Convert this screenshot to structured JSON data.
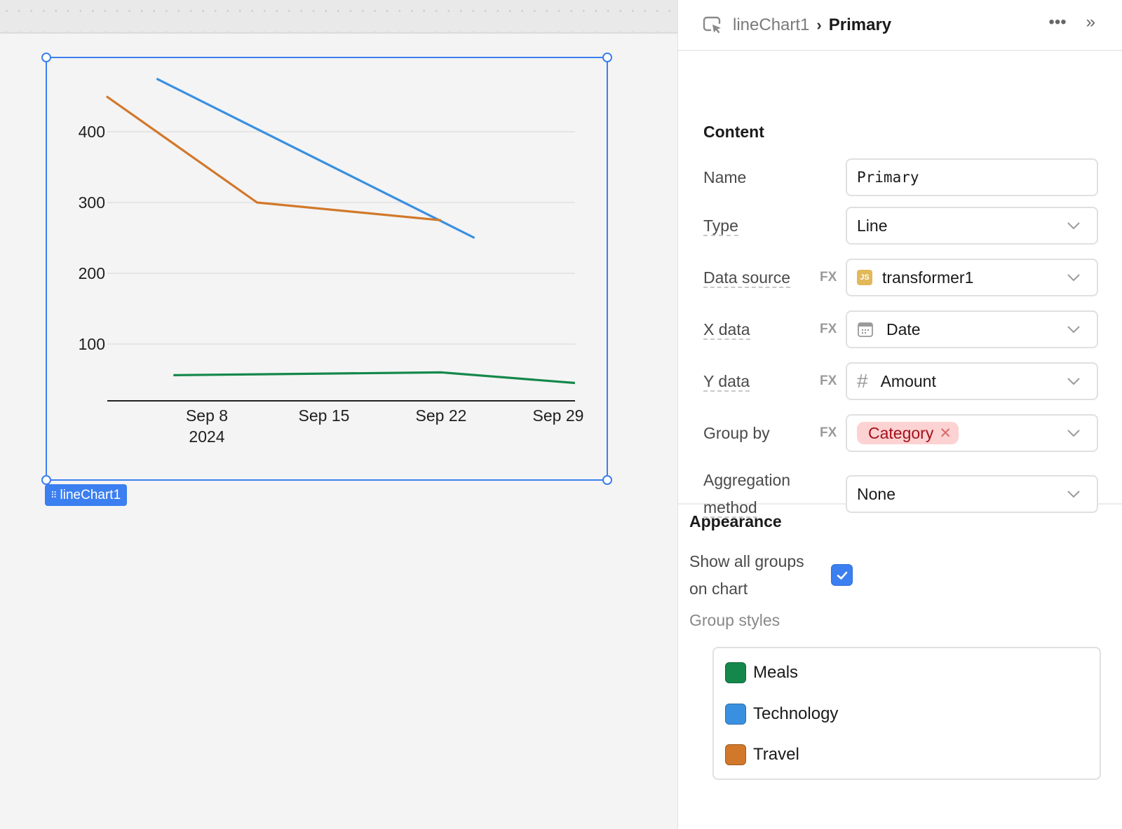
{
  "canvas": {
    "component_badge": "lineChart1",
    "selection_color": "#3b7ff0"
  },
  "chart_data": {
    "type": "line",
    "title": "",
    "xlabel": "",
    "ylabel": "",
    "x_ticks": [
      {
        "date": "2024-09-08",
        "label": "Sep 8",
        "sublabel": "2024"
      },
      {
        "date": "2024-09-15",
        "label": "Sep 15",
        "sublabel": ""
      },
      {
        "date": "2024-09-22",
        "label": "Sep 22",
        "sublabel": ""
      },
      {
        "date": "2024-09-29",
        "label": "Sep 29",
        "sublabel": ""
      }
    ],
    "y_ticks": [
      100,
      200,
      300,
      400
    ],
    "ylim": [
      20,
      490
    ],
    "xlim": [
      "2024-09-02",
      "2024-09-30"
    ],
    "grid": true,
    "series": [
      {
        "name": "Meals",
        "color": "#14884a",
        "points": [
          {
            "x": "2024-09-06",
            "y": 56
          },
          {
            "x": "2024-09-22",
            "y": 60
          },
          {
            "x": "2024-09-30",
            "y": 45
          }
        ]
      },
      {
        "name": "Technology",
        "color": "#3a90e0",
        "points": [
          {
            "x": "2024-09-05",
            "y": 475
          },
          {
            "x": "2024-09-24",
            "y": 250
          }
        ]
      },
      {
        "name": "Travel",
        "color": "#d2782a",
        "points": [
          {
            "x": "2024-09-02",
            "y": 450
          },
          {
            "x": "2024-09-11",
            "y": 300
          },
          {
            "x": "2024-09-22",
            "y": 275
          }
        ]
      }
    ]
  },
  "panel": {
    "header": {
      "icon": "cursor-select-icon",
      "breadcrumb_parent": "lineChart1",
      "breadcrumb_separator": "›",
      "breadcrumb_current": "Primary",
      "more_icon": "•••",
      "collapse_icon": "»"
    },
    "content": {
      "title": "Content",
      "name_label": "Name",
      "name_value": "Primary",
      "type_label": "Type",
      "type_value": "Line",
      "data_source_label": "Data source",
      "data_source_value": "transformer1",
      "data_source_icon_text": "JS",
      "x_data_label": "X data",
      "x_data_value": "Date",
      "y_data_label": "Y data",
      "y_data_value": "Amount",
      "y_data_icon": "#",
      "group_by_label": "Group by",
      "group_by_tag": "Category",
      "group_by_remove": "✕",
      "aggregation_label_line1": "Aggregation",
      "aggregation_label_line2": "method",
      "aggregation_value": "None",
      "fx_label": "FX"
    },
    "appearance": {
      "title": "Appearance",
      "show_all_groups_line1": "Show all groups",
      "show_all_groups_line2": "on chart",
      "show_all_groups_checked": true,
      "group_styles_label": "Group styles",
      "groups": [
        {
          "name": "Meals",
          "color": "#14884a"
        },
        {
          "name": "Technology",
          "color": "#3a90e0"
        },
        {
          "name": "Travel",
          "color": "#d2782a"
        }
      ]
    }
  }
}
